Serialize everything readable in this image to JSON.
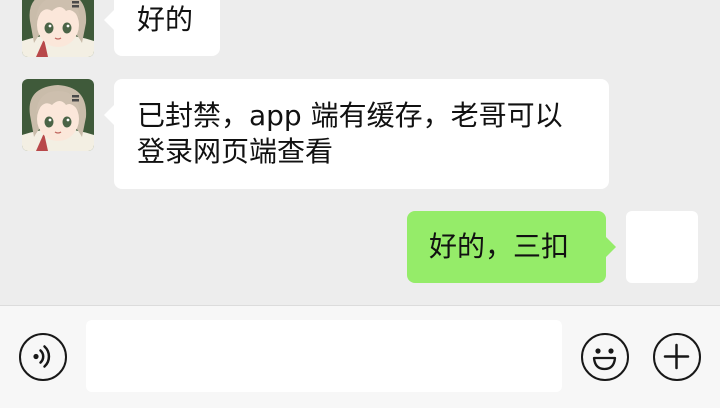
{
  "messages": [
    {
      "direction": "incoming",
      "text": "好的"
    },
    {
      "direction": "incoming",
      "lines": [
        "已封禁，app 端有缓存，老哥可以",
        "登录网页端查看"
      ]
    },
    {
      "direction": "outgoing",
      "text": "好的，三扣"
    }
  ],
  "input_bar": {
    "message_value": "",
    "voice_icon": "voice-icon",
    "emoji_icon": "emoji-icon",
    "plus_icon": "plus-icon"
  },
  "colors": {
    "chat_background": "#ededed",
    "incoming_bubble": "#ffffff",
    "outgoing_bubble": "#95ec69",
    "input_bar_background": "#f7f7f7"
  }
}
